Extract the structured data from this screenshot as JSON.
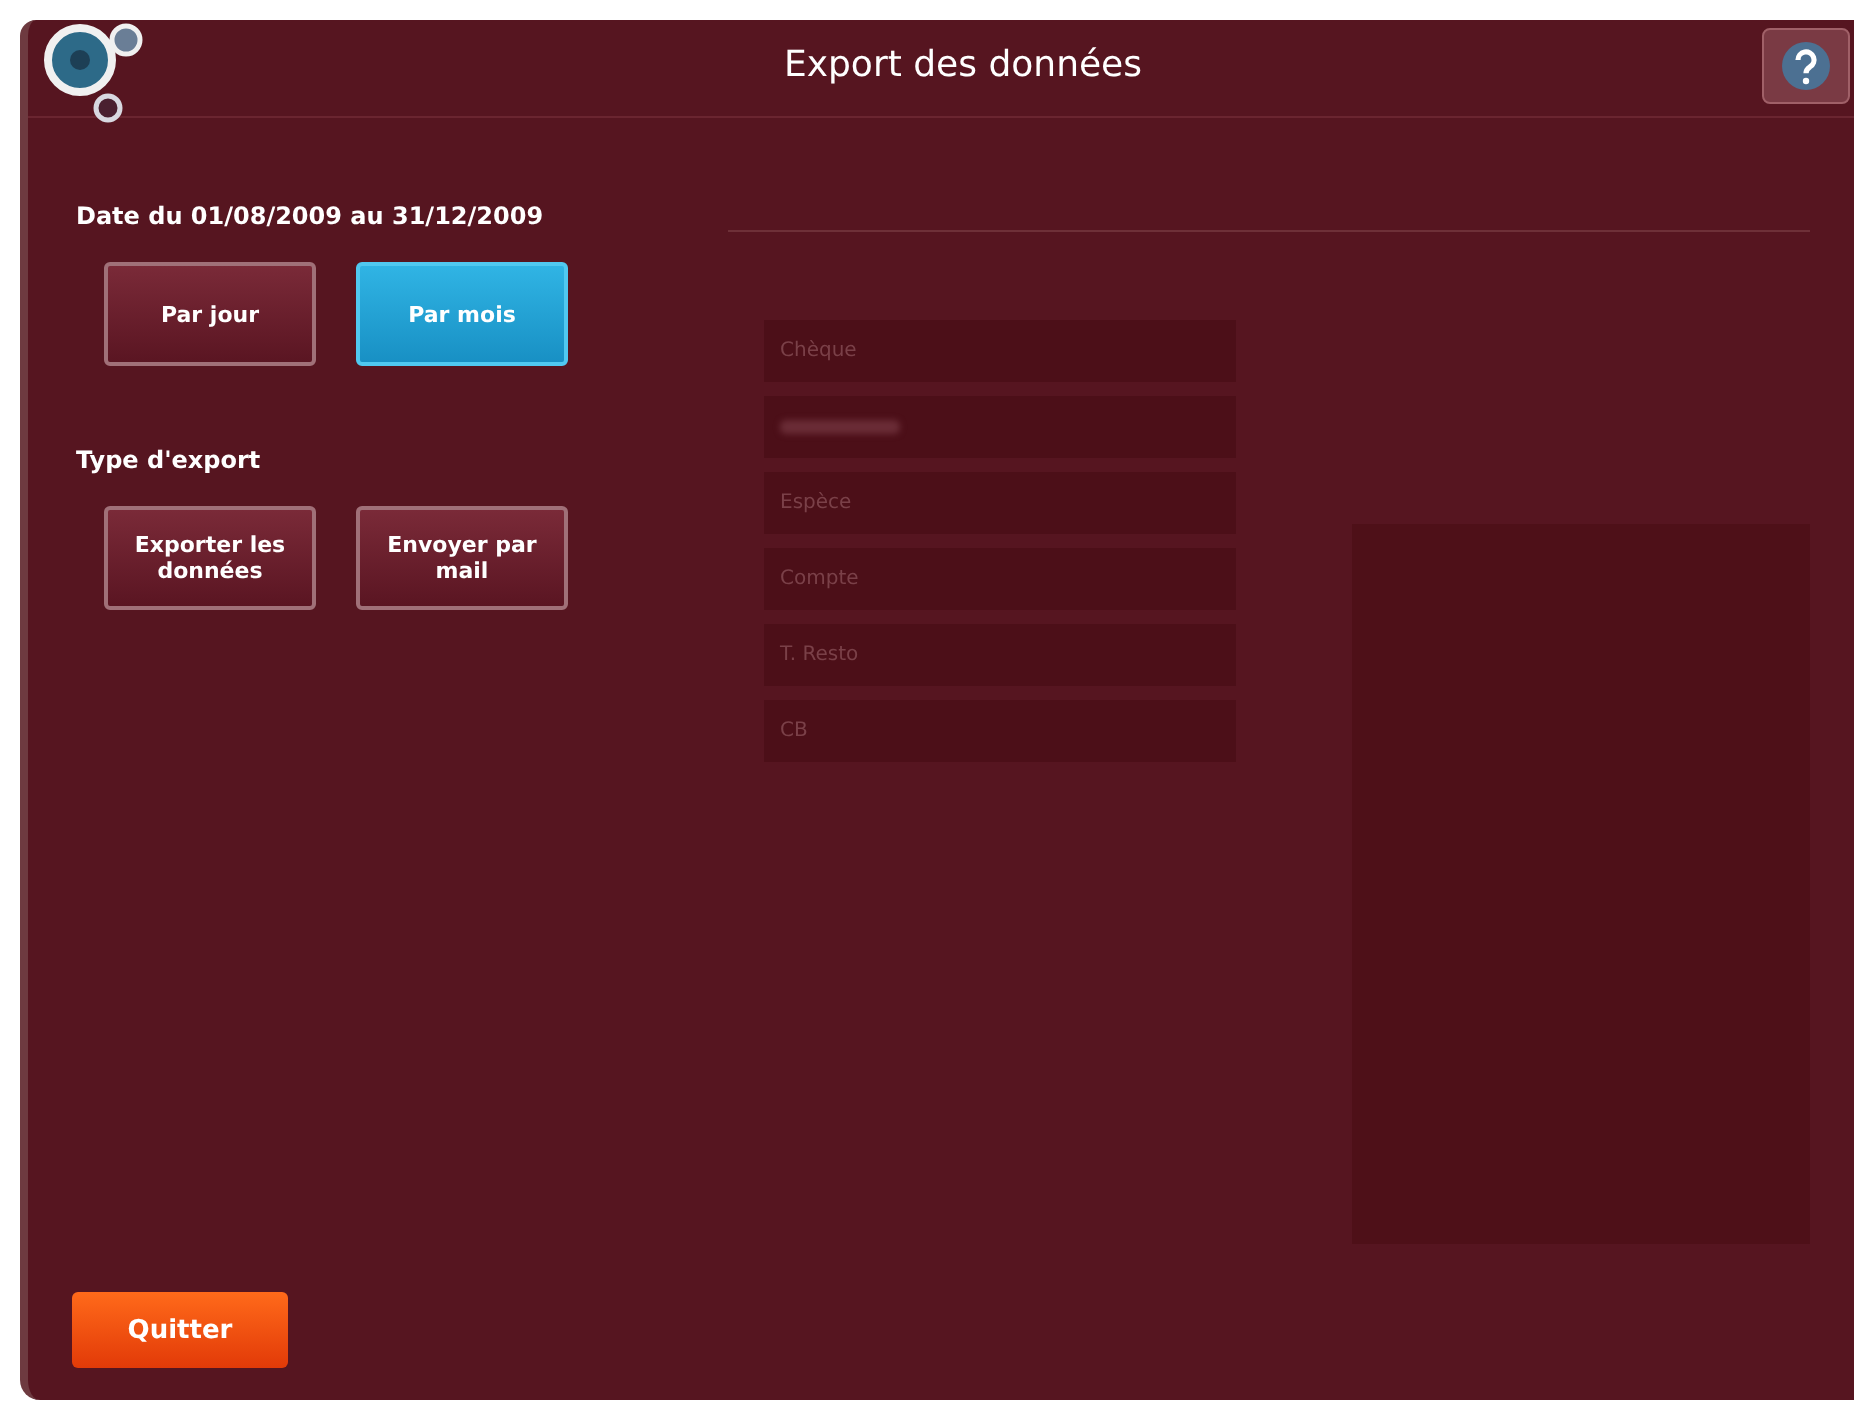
{
  "window": {
    "title": "Export des données"
  },
  "period": {
    "label": "Date du 01/08/2009 au 31/12/2009",
    "options": [
      {
        "label": "Par jour",
        "selected": false
      },
      {
        "label": "Par mois",
        "selected": true
      }
    ]
  },
  "export": {
    "label": "Type d'export",
    "actions": [
      "Exporter les données",
      "Envoyer par mail"
    ]
  },
  "background_list": [
    {
      "kind": "text",
      "label": "Chèque"
    },
    {
      "kind": "illegible"
    },
    {
      "kind": "text",
      "label": "Espèce"
    },
    {
      "kind": "text",
      "label": "Compte"
    },
    {
      "kind": "text",
      "label": "T. Resto"
    },
    {
      "kind": "text",
      "label": "CB"
    }
  ],
  "quit_button": "Quitter"
}
